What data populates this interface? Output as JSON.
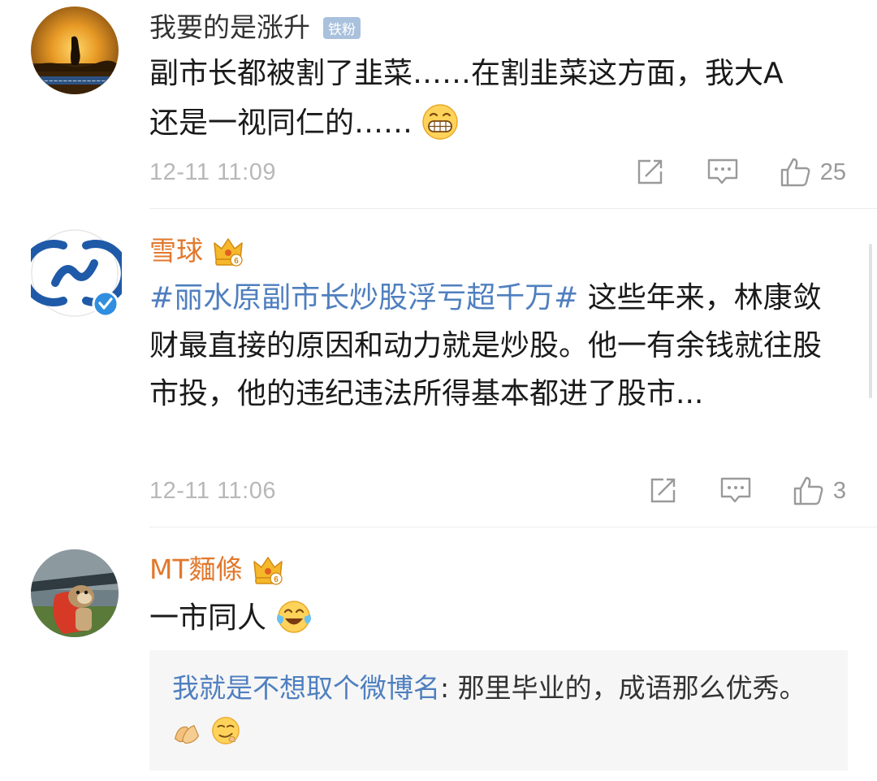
{
  "comments": [
    {
      "username": "我要的是涨升",
      "badge": "铁粉",
      "avatar_icon": "sunset-person-avatar",
      "body_line1": "副市长都被割了韭菜……在割韭菜这方面，我大A",
      "body_line2": "还是一视同仁的……",
      "emoji": "grin-emoji",
      "timestamp": "12-11 11:09",
      "like_count": "25"
    },
    {
      "username": "雪球",
      "avatar_icon": "snowball-logo-avatar",
      "hashtag": "#丽水原副市长炒股浮亏超千万#",
      "body_rest": " 这些年来，林康敛财最直接的原因和动力就是炒股。他一有余钱就往股市投，他的违纪违法所得基本都进了股市...",
      "timestamp": "12-11 11:06",
      "like_count": "3"
    },
    {
      "username": "MT麵條",
      "avatar_icon": "dog-cape-avatar",
      "body": "一市同人",
      "emoji": "tears-of-joy-emoji",
      "reply": {
        "username": "我就是不想取个微博名",
        "separator": ": ",
        "text": "那里毕业的，成语那么优秀。",
        "emojis": [
          "clap-hands-emoji",
          "smirk-emoji"
        ]
      }
    }
  ],
  "colors": {
    "hashtag": "#4f7fbf",
    "vip_name": "#e2782c",
    "meta": "#b8b8b8",
    "reply_bg": "#f6f6f6"
  }
}
